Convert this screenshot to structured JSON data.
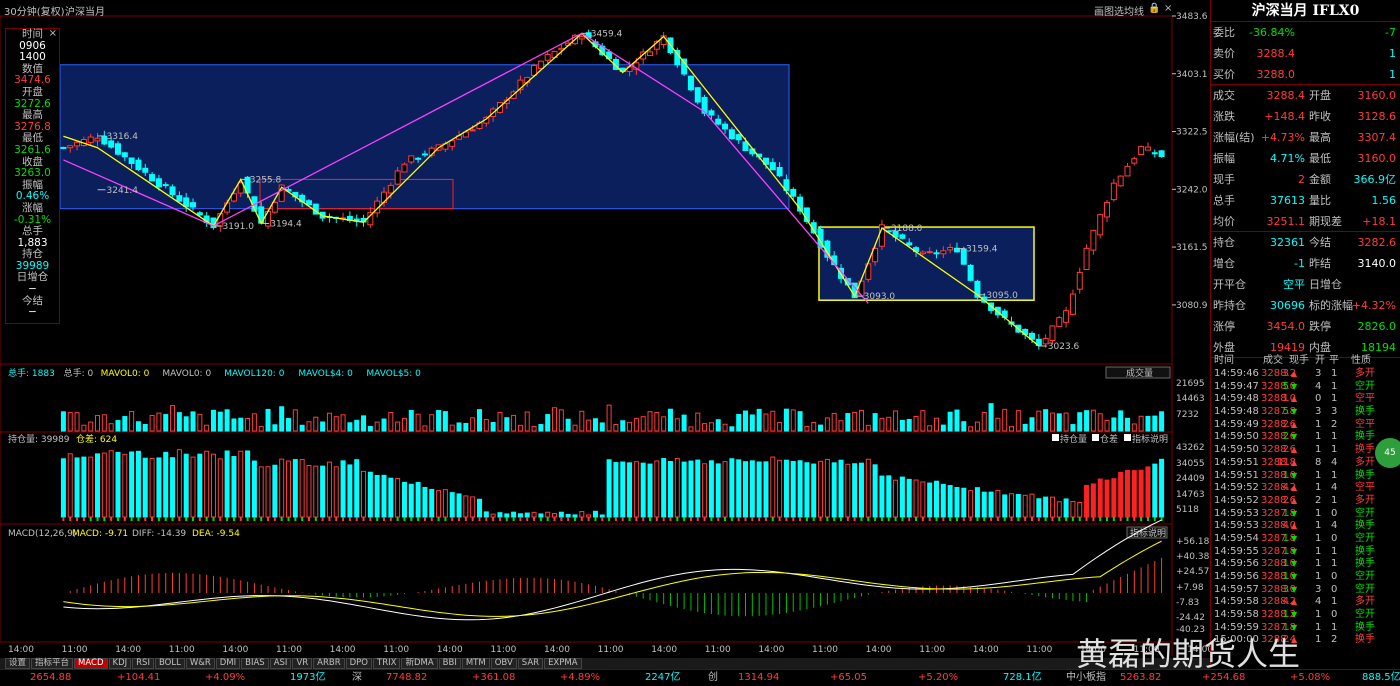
{
  "header": {
    "period": "30分钟(复权)",
    "name": "沪深当月",
    "btn_stats": "画图选",
    "btn_draw": "均线",
    "btn_lock": "🔒",
    "btn_x": "×"
  },
  "info_panel": [
    {
      "label": "时间",
      "value": "0906",
      "vc": "wht"
    },
    {
      "label": "",
      "value": "1400",
      "vc": "wht"
    },
    {
      "label": "数值",
      "value": "3474.6",
      "vc": "red"
    },
    {
      "label": "开盘",
      "value": "3272.6",
      "vc": "grn"
    },
    {
      "label": "最高",
      "value": "3276.8",
      "vc": "red"
    },
    {
      "label": "最低",
      "value": "3261.6",
      "vc": "grn"
    },
    {
      "label": "收盘",
      "value": "3263.0",
      "vc": "grn"
    },
    {
      "label": "振幅",
      "value": "0.46%",
      "vc": "cyn"
    },
    {
      "label": "涨幅",
      "value": "-0.31%",
      "vc": "grn"
    },
    {
      "label": "总手",
      "value": "1,883",
      "vc": "wht"
    },
    {
      "label": "持仓",
      "value": "39989",
      "vc": "cyn"
    },
    {
      "label": "日增仓",
      "value": "−",
      "vc": "wht"
    },
    {
      "label": "今结",
      "value": "−",
      "vc": "wht"
    }
  ],
  "quote": {
    "title": "沪深当月 IFLX0",
    "rows1": [
      [
        [
          "委比",
          "gray"
        ],
        [
          "-36.84%",
          "grn"
        ],
        [
          "-7",
          "grn"
        ]
      ],
      [
        [
          "卖价",
          "gray"
        ],
        [
          "3288.4",
          "red"
        ],
        [
          "1",
          "cyn"
        ]
      ],
      [
        [
          "买价",
          "gray"
        ],
        [
          "3288.0",
          "red"
        ],
        [
          "1",
          "cyn"
        ]
      ]
    ],
    "rows2": [
      [
        [
          "成交",
          "gray"
        ],
        [
          "3288.4",
          "red"
        ],
        [
          "开盘",
          "gray"
        ],
        [
          "3160.0",
          "red"
        ]
      ],
      [
        [
          "涨跌",
          "gray"
        ],
        [
          "+148.4",
          "red"
        ],
        [
          "昨收",
          "gray"
        ],
        [
          "3128.6",
          "red"
        ]
      ],
      [
        [
          "涨幅(结)",
          "gray"
        ],
        [
          "+4.73%",
          "red"
        ],
        [
          "最高",
          "gray"
        ],
        [
          "3307.4",
          "red"
        ]
      ],
      [
        [
          "振幅",
          "gray"
        ],
        [
          "4.71%",
          "cyn"
        ],
        [
          "最低",
          "gray"
        ],
        [
          "3160.0",
          "red"
        ]
      ],
      [
        [
          "现手",
          "gray"
        ],
        [
          "2",
          "red"
        ],
        [
          "金额",
          "gray"
        ],
        [
          "366.9亿",
          "cyn"
        ]
      ],
      [
        [
          "总手",
          "gray"
        ],
        [
          "37613",
          "cyn"
        ],
        [
          "量比",
          "gray"
        ],
        [
          "1.56",
          "cyn"
        ]
      ],
      [
        [
          "均价",
          "gray"
        ],
        [
          "3251.1",
          "red"
        ],
        [
          "期现差",
          "gray"
        ],
        [
          "+18.1",
          "red"
        ]
      ]
    ],
    "rows3": [
      [
        [
          "持仓",
          "gray"
        ],
        [
          "32361",
          "cyn"
        ],
        [
          "今结",
          "gray"
        ],
        [
          "3282.6",
          "red"
        ]
      ],
      [
        [
          "增仓",
          "gray"
        ],
        [
          "-1",
          "cyn"
        ],
        [
          "昨结",
          "gray"
        ],
        [
          "3140.0",
          "wht"
        ]
      ],
      [
        [
          "开平仓",
          "gray"
        ],
        [
          "空平",
          "cyn"
        ],
        [
          "日增仓",
          "gray"
        ],
        [
          "",
          "wht"
        ]
      ],
      [
        [
          "昨持仓",
          "gray"
        ],
        [
          "30696",
          "cyn"
        ],
        [
          "标的涨幅",
          "gray"
        ],
        [
          "+4.32%",
          "red"
        ]
      ],
      [
        [
          "涨停",
          "gray"
        ],
        [
          "3454.0",
          "red"
        ],
        [
          "跌停",
          "gray"
        ],
        [
          "2826.0",
          "grn"
        ]
      ],
      [
        [
          "外盘",
          "gray"
        ],
        [
          "19419",
          "red"
        ],
        [
          "内盘",
          "gray"
        ],
        [
          "18194",
          "grn"
        ]
      ]
    ]
  },
  "ticks_header": {
    "time": "时间",
    "price": "成交",
    "hand": "现手",
    "open": "开",
    "close": "平",
    "nature": "性质"
  },
  "ticks": [
    {
      "time": "14:59:46",
      "price": "3288.2",
      "hand": "3",
      "dir": "up",
      "open": "3",
      "close": "1",
      "nature": "多开",
      "nc": "red"
    },
    {
      "time": "14:59:47",
      "price": "3288.0",
      "hand": "5",
      "dir": "dn",
      "open": "4",
      "close": "1",
      "nature": "空开",
      "nc": "grn"
    },
    {
      "time": "14:59:48",
      "price": "3288.0",
      "hand": "1",
      "dir": "up",
      "open": "0",
      "close": "1",
      "nature": "空平",
      "nc": "red"
    },
    {
      "time": "14:59:48",
      "price": "3287.8",
      "hand": "5",
      "dir": "dn",
      "open": "3",
      "close": "3",
      "nature": "换手",
      "nc": "grn"
    },
    {
      "time": "14:59:49",
      "price": "3288.6",
      "hand": "2",
      "dir": "up",
      "open": "1",
      "close": "2",
      "nature": "空平",
      "nc": "red"
    },
    {
      "time": "14:59:50",
      "price": "3288.6",
      "hand": "2",
      "dir": "dn",
      "open": "1",
      "close": "1",
      "nature": "换手",
      "nc": "grn"
    },
    {
      "time": "14:59:50",
      "price": "3288.6",
      "hand": "2",
      "dir": "up",
      "open": "1",
      "close": "1",
      "nature": "换手",
      "nc": "red"
    },
    {
      "time": "14:59:51",
      "price": "3288.8",
      "hand": "11",
      "dir": "up",
      "open": "8",
      "close": "4",
      "nature": "多开",
      "nc": "red"
    },
    {
      "time": "14:59:51",
      "price": "3288.0",
      "hand": "1",
      "dir": "dn",
      "open": "1",
      "close": "1",
      "nature": "换手",
      "nc": "grn"
    },
    {
      "time": "14:59:52",
      "price": "3288.2",
      "hand": "4",
      "dir": "up",
      "open": "1",
      "close": "4",
      "nature": "空平",
      "nc": "red"
    },
    {
      "time": "14:59:52",
      "price": "3288.6",
      "hand": "2",
      "dir": "up",
      "open": "2",
      "close": "1",
      "nature": "多开",
      "nc": "red"
    },
    {
      "time": "14:59:53",
      "price": "3287.8",
      "hand": "1",
      "dir": "dn",
      "open": "1",
      "close": "0",
      "nature": "空开",
      "nc": "grn"
    },
    {
      "time": "14:59:53",
      "price": "3288.0",
      "hand": "4",
      "dir": "up",
      "open": "1",
      "close": "4",
      "nature": "换手",
      "nc": "grn"
    },
    {
      "time": "14:59:54",
      "price": "3287.8",
      "hand": "1",
      "dir": "dn",
      "open": "1",
      "close": "0",
      "nature": "空开",
      "nc": "grn"
    },
    {
      "time": "14:59:55",
      "price": "3287.8",
      "hand": "1",
      "dir": "dn",
      "open": "1",
      "close": "1",
      "nature": "换手",
      "nc": "grn"
    },
    {
      "time": "14:59:56",
      "price": "3288.0",
      "hand": "1",
      "dir": "dn",
      "open": "1",
      "close": "1",
      "nature": "换手",
      "nc": "grn"
    },
    {
      "time": "14:59:56",
      "price": "3288.0",
      "hand": "1",
      "dir": "dn",
      "open": "1",
      "close": "0",
      "nature": "空开",
      "nc": "grn"
    },
    {
      "time": "14:59:57",
      "price": "3288.0",
      "hand": "3",
      "dir": "dn",
      "open": "3",
      "close": "0",
      "nature": "空开",
      "nc": "grn"
    },
    {
      "time": "14:59:58",
      "price": "3288.2",
      "hand": "4",
      "dir": "up",
      "open": "4",
      "close": "1",
      "nature": "多开",
      "nc": "red"
    },
    {
      "time": "14:59:58",
      "price": "3288.2",
      "hand": "1",
      "dir": "dn",
      "open": "1",
      "close": "0",
      "nature": "空开",
      "nc": "grn"
    },
    {
      "time": "14:59:59",
      "price": "3287.8",
      "hand": "1",
      "dir": "dn",
      "open": "1",
      "close": "1",
      "nature": "换手",
      "nc": "grn"
    },
    {
      "time": "15:00:00",
      "price": "3288.4",
      "hand": "2",
      "dir": "up",
      "open": "1",
      "close": "2",
      "nature": "换手",
      "nc": "red"
    }
  ],
  "tabs": [
    "设置",
    "指标平台",
    "MACD",
    "KDJ",
    "RSI",
    "BOLL",
    "W&R",
    "DMI",
    "BIAS",
    "ASI",
    "VR",
    "ARBR",
    "DPO",
    "TRIX",
    "新DMA",
    "BBI",
    "MTM",
    "OBV",
    "SAR",
    "EXPMA"
  ],
  "active_tab": "MACD",
  "status": [
    {
      "t": "2654.88",
      "c": "#ff3c3c"
    },
    {
      "t": "+104.41",
      "c": "#ff3c3c"
    },
    {
      "t": "+4.09%",
      "c": "#ff3c3c"
    },
    {
      "t": "1973亿",
      "c": "#00ffff"
    },
    {
      "t": "深",
      "c": "#c0c0c0"
    },
    {
      "t": "7748.82",
      "c": "#ff3c3c"
    },
    {
      "t": "+361.08",
      "c": "#ff3c3c"
    },
    {
      "t": "+4.89%",
      "c": "#ff3c3c"
    },
    {
      "t": "2247亿",
      "c": "#00ffff"
    },
    {
      "t": "创",
      "c": "#c0c0c0"
    },
    {
      "t": "1314.94",
      "c": "#ff3c3c"
    },
    {
      "t": "+65.05",
      "c": "#ff3c3c"
    },
    {
      "t": "+5.20%",
      "c": "#ff3c3c"
    },
    {
      "t": "728.1亿",
      "c": "#00ffff"
    },
    {
      "t": "中小板指",
      "c": "#c0c0c0"
    },
    {
      "t": "5263.82",
      "c": "#ff3c3c"
    },
    {
      "t": "+254.68",
      "c": "#ff3c3c"
    },
    {
      "t": "+5.08%",
      "c": "#ff3c3c"
    },
    {
      "t": "888.5亿",
      "c": "#00ffff"
    }
  ],
  "watermark": "黄磊的期货人生",
  "fab": "45",
  "chart_data": [
    {
      "type": "candlestick",
      "name": "price",
      "ylim": [
        3023.6,
        3483.6
      ],
      "y_ticks": [
        "3483.6",
        "3403.1",
        "3322.5",
        "3242.0",
        "3161.5",
        "3080.9"
      ],
      "annotations": [
        "3316.4",
        "3241.4",
        "3191.0",
        "3255.8",
        "3194.4",
        "3459.4",
        "3188.0",
        "3159.4",
        "3093.0",
        "3095.0",
        "3023.6"
      ],
      "keypoints": [
        {
          "i": 0,
          "v": 3300
        },
        {
          "i": 5,
          "v": 3316.4
        },
        {
          "i": 22,
          "v": 3191.0
        },
        {
          "i": 26,
          "v": 3255.8
        },
        {
          "i": 29,
          "v": 3194.4
        },
        {
          "i": 32,
          "v": 3245
        },
        {
          "i": 38,
          "v": 3205
        },
        {
          "i": 44,
          "v": 3196
        },
        {
          "i": 50,
          "v": 3280
        },
        {
          "i": 55,
          "v": 3300
        },
        {
          "i": 62,
          "v": 3340
        },
        {
          "i": 70,
          "v": 3420
        },
        {
          "i": 76,
          "v": 3459.4
        },
        {
          "i": 82,
          "v": 3405
        },
        {
          "i": 88,
          "v": 3455
        },
        {
          "i": 94,
          "v": 3350
        },
        {
          "i": 100,
          "v": 3300
        },
        {
          "i": 104,
          "v": 3270
        },
        {
          "i": 108,
          "v": 3215
        },
        {
          "i": 112,
          "v": 3150
        },
        {
          "i": 116,
          "v": 3093.0
        },
        {
          "i": 120,
          "v": 3188.0
        },
        {
          "i": 126,
          "v": 3150
        },
        {
          "i": 131,
          "v": 3159.4
        },
        {
          "i": 134,
          "v": 3095.0
        },
        {
          "i": 138,
          "v": 3060
        },
        {
          "i": 143,
          "v": 3023.6
        },
        {
          "i": 147,
          "v": 3070
        },
        {
          "i": 150,
          "v": 3160
        },
        {
          "i": 154,
          "v": 3250
        },
        {
          "i": 158,
          "v": 3300
        },
        {
          "i": 161,
          "v": 3288.4
        }
      ]
    },
    {
      "type": "bar",
      "name": "volume",
      "legend": [
        "总手: 1883",
        "总手: 0",
        "MAVOL0: 0",
        "MAVOL0: 0",
        "MAVOL120: 0",
        "MAVOL$4: 0",
        "MAVOL$5: 0"
      ],
      "dropdown": "成交量",
      "y_ticks": [
        "21695",
        "14463",
        "7232"
      ]
    },
    {
      "type": "bar",
      "name": "open_interest",
      "legend": [
        "持仓量: 39989",
        "仓差: 624"
      ],
      "checks": [
        "持仓量",
        "仓差",
        "指标说明"
      ],
      "y_ticks": [
        "43262",
        "34055",
        "24409",
        "14763",
        "5118"
      ]
    },
    {
      "type": "line",
      "name": "MACD",
      "params": "MACD(12,26,9)",
      "values": {
        "MACD": "-9.71",
        "DIFF": "-14.39",
        "DEA": "-9.54"
      },
      "button": "指标说明",
      "y_ticks": [
        "+56.18",
        "+40.38",
        "+24.57",
        "+7.98",
        "-7.83",
        "-24.42",
        "-40.23"
      ]
    }
  ],
  "x_ticks": [
    "14:00",
    "11:00",
    "14:00",
    "11:00",
    "14:00",
    "11:00",
    "14:00",
    "11:00",
    "14:00",
    "11:00",
    "14:00",
    "11:00",
    "14:00",
    "11:00",
    "14:00",
    "11:00",
    "14:00",
    "11:00",
    "14:00",
    "11:00",
    "14:00",
    "11:00",
    "14:00"
  ]
}
